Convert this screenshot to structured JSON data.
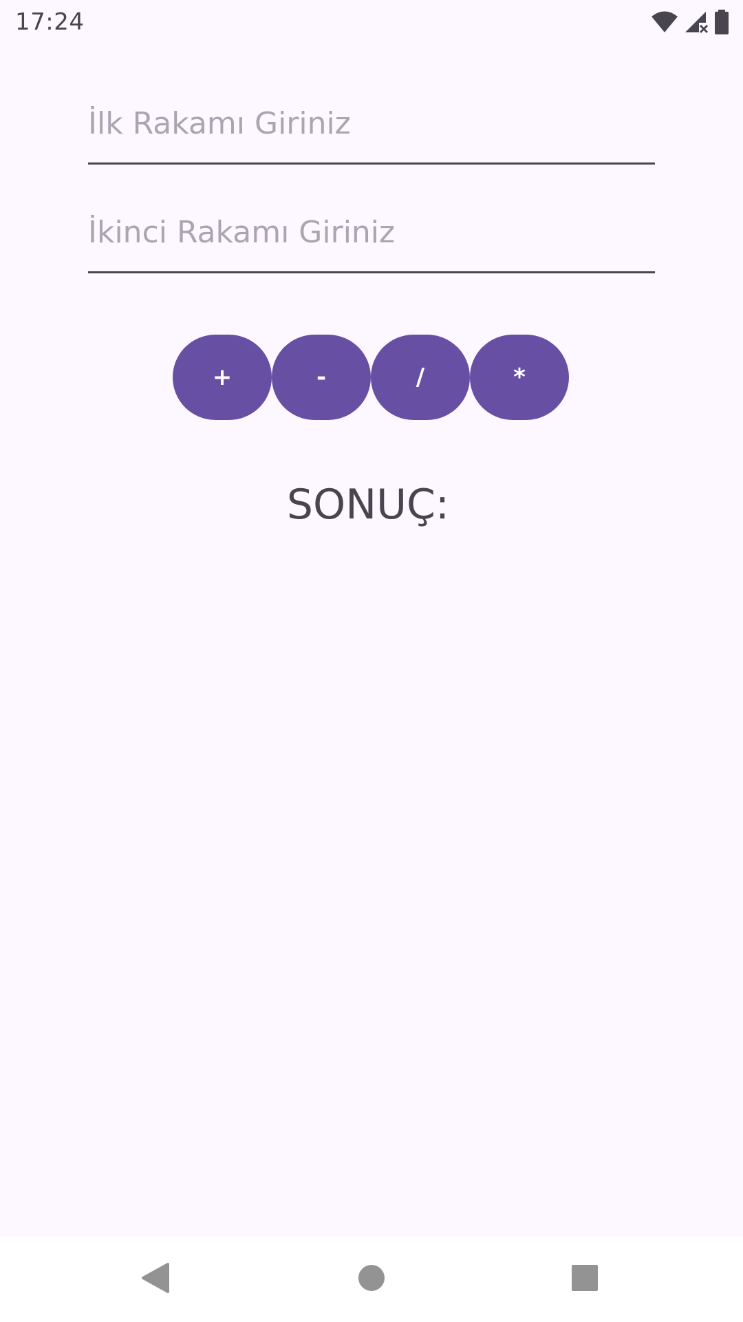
{
  "status_bar": {
    "time": "17:24",
    "icons": [
      "wifi-icon",
      "cell-signal-no-service-icon",
      "battery-icon"
    ],
    "icon_color": "#49454f"
  },
  "form": {
    "first_number": {
      "placeholder": "İlk Rakamı Giriniz",
      "value": ""
    },
    "second_number": {
      "placeholder": "İkinci Rakamı Giriniz",
      "value": ""
    }
  },
  "operations": [
    {
      "label": "+"
    },
    {
      "label": "-"
    },
    {
      "label": "/"
    },
    {
      "label": "*"
    }
  ],
  "result": {
    "label": "SONUÇ:"
  },
  "nav_bar": {
    "icons": [
      "back-icon",
      "home-icon",
      "recents-icon"
    ],
    "icon_color": "#939393"
  },
  "colors": {
    "background": "#fdf7ff",
    "button": "#6750a4",
    "button_text": "#ffffff",
    "text": "#49454f",
    "placeholder": "#aba5b1"
  }
}
